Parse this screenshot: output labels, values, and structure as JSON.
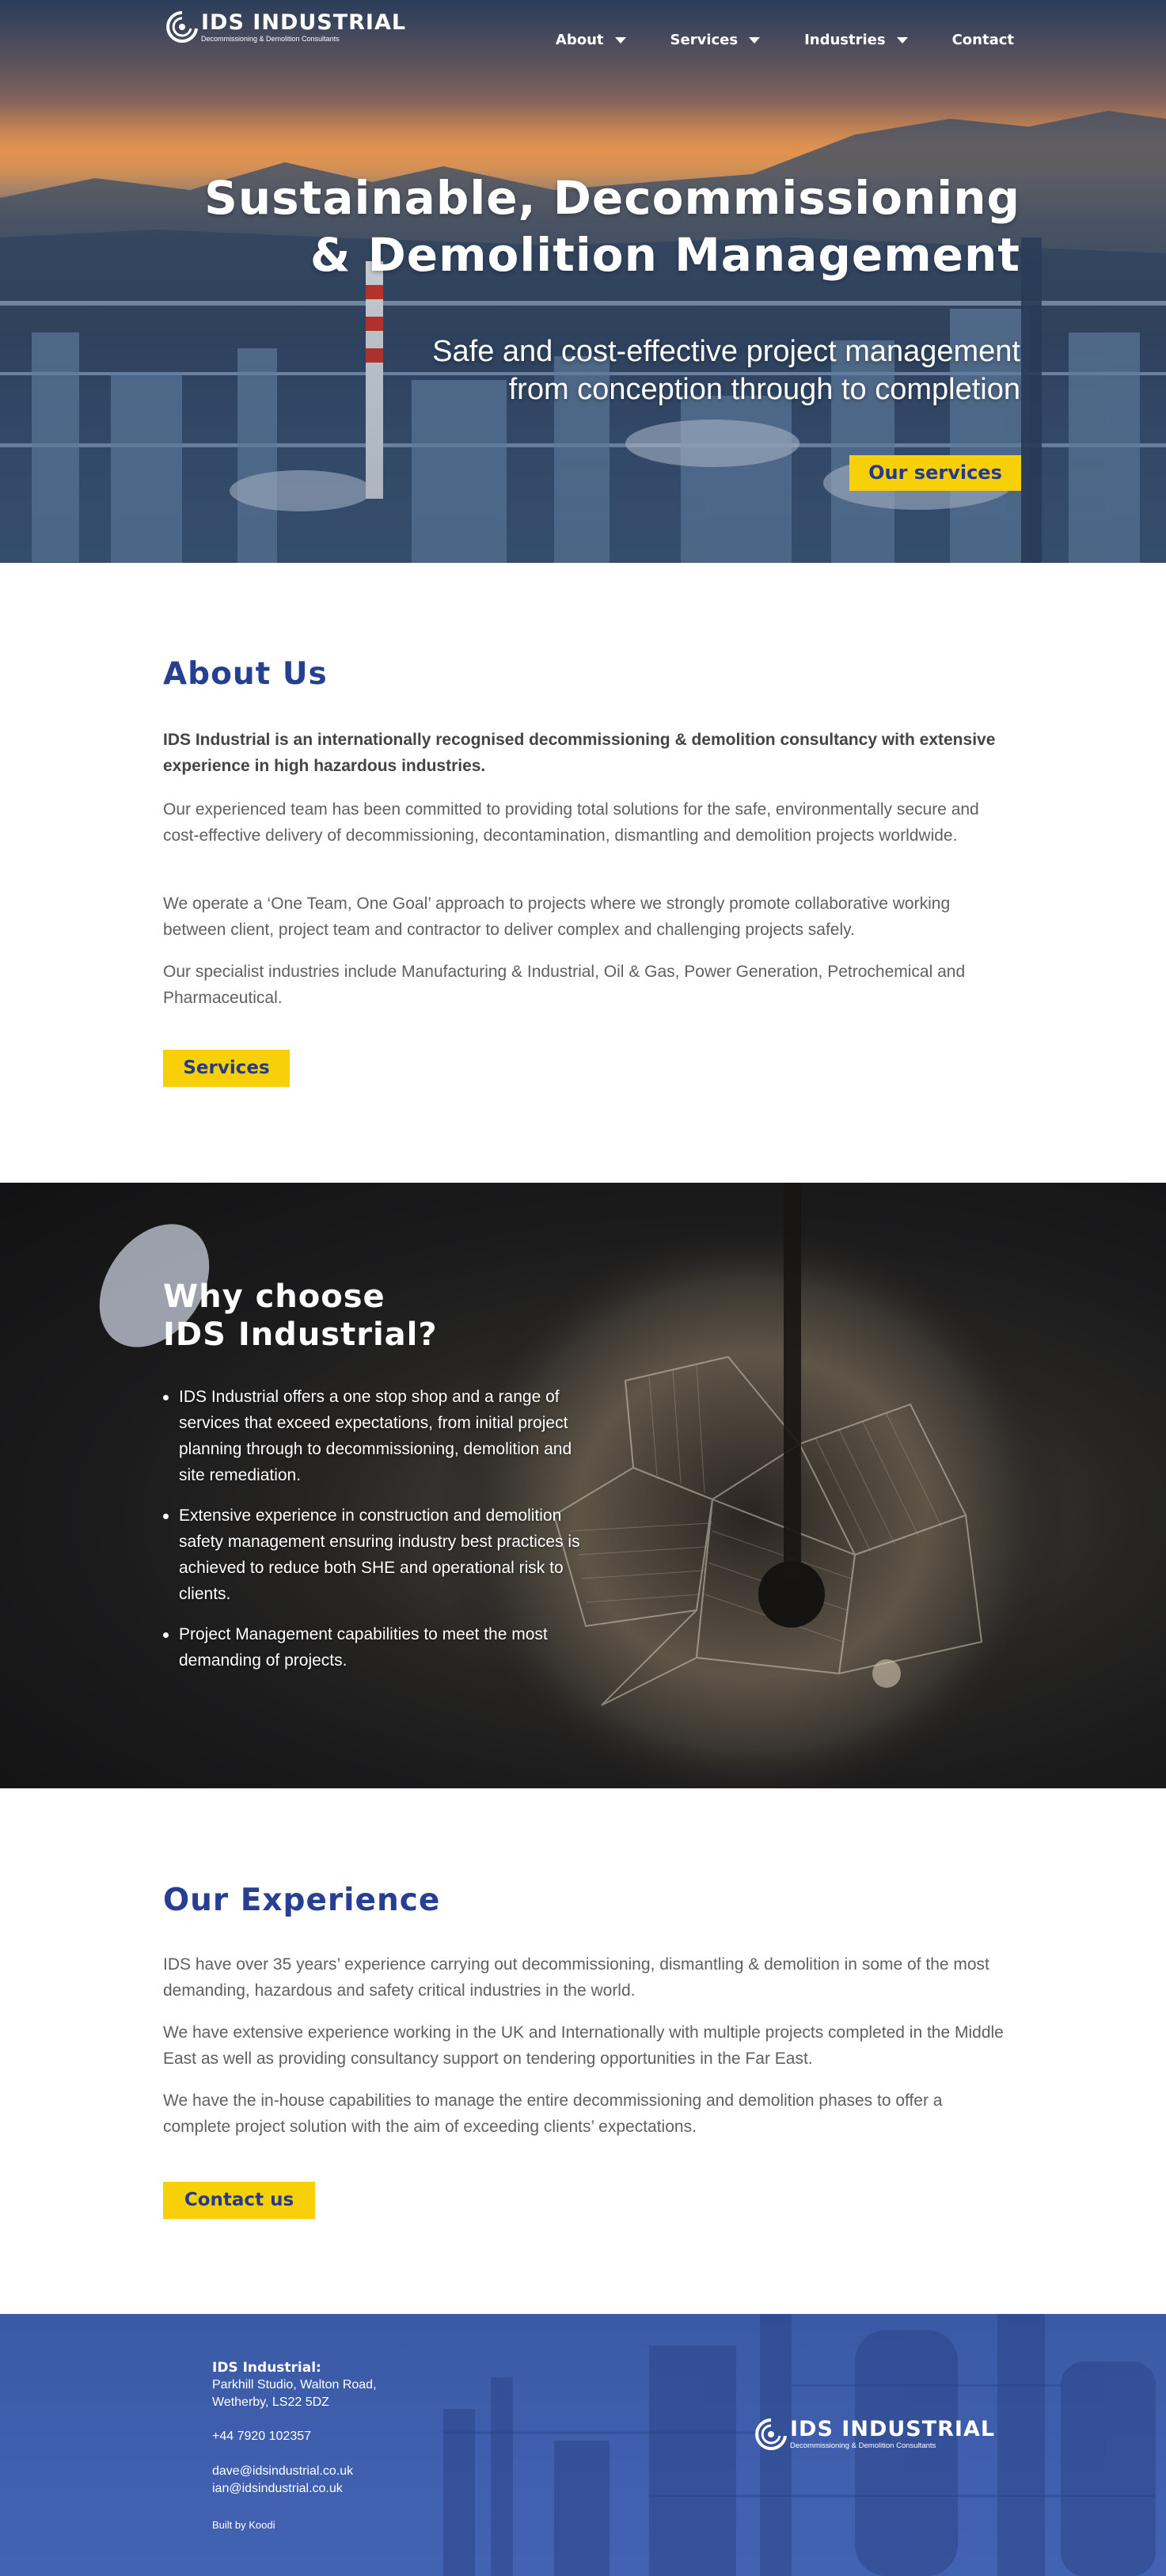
{
  "brand": {
    "name": "IDS INDUSTRIAL",
    "tagline": "Decommissioning & Demolition Consultants"
  },
  "nav": {
    "items": [
      {
        "label": "About",
        "has_dropdown": true
      },
      {
        "label": "Services",
        "has_dropdown": true
      },
      {
        "label": "Industries",
        "has_dropdown": true
      },
      {
        "label": "Contact",
        "has_dropdown": false
      }
    ]
  },
  "hero": {
    "title_line1": "Sustainable, Decommissioning",
    "title_line2": "& Demolition Management",
    "subtitle_line1": "Safe and cost-effective project management",
    "subtitle_line2": "from conception through to completion",
    "button_label": "Our services"
  },
  "about": {
    "title": "About Us",
    "lead": "IDS Industrial is an internationally recognised decommissioning & demolition consultancy with extensive experience in high hazardous industries.",
    "paragraphs": [
      "Our experienced team has been committed to providing total solutions for the safe, environmentally secure and cost-effective delivery of decommissioning, decontamination, dismantling and demolition projects worldwide.",
      "We operate a ‘One Team, One Goal’ approach to projects where we strongly promote collaborative working between client, project team and contractor to deliver complex and challenging projects safely.",
      "Our specialist industries include Manufacturing & Industrial, Oil & Gas, Power Generation, Petrochemical and Pharmaceutical."
    ],
    "button_label": "Services"
  },
  "why": {
    "title_line1": "Why choose",
    "title_line2": "IDS Industrial?",
    "points": [
      "IDS Industrial offers a one stop shop and a range of services that exceed expectations, from initial project planning through to decommissioning, demolition and site remediation.",
      "Extensive experience in construction and demolition safety management ensuring industry best practices is achieved to reduce both SHE and operational risk to clients.",
      "Project Management capabilities to meet the most demanding of projects."
    ]
  },
  "experience": {
    "title": "Our Experience",
    "paragraphs": [
      "IDS have over 35 years’ experience carrying out decommissioning, dismantling & demolition in some of the most demanding, hazardous and safety critical industries in the world.",
      "We have extensive experience working in the UK and Internationally with multiple projects completed in the Middle East as well as providing consultancy support on tendering opportunities in the Far East.",
      "We have the in-house capabilities to manage the entire decommissioning and demolition phases to offer a complete project solution with the aim of exceeding clients’ expectations."
    ],
    "button_label": "Contact us"
  },
  "footer": {
    "company": "IDS Industrial:",
    "address_line1": "Parkhill Studio, Walton Road,",
    "address_line2": "Wetherby, LS22 5DZ",
    "phone": "+44 7920 102357",
    "email1": "dave@idsindustrial.co.uk",
    "email2": "ian@idsindustrial.co.uk",
    "credit": "Built by Koodi"
  },
  "colors": {
    "brand_blue": "#263f92",
    "accent_yellow": "#f7d00a",
    "footer_blue": "#3f5fae"
  }
}
